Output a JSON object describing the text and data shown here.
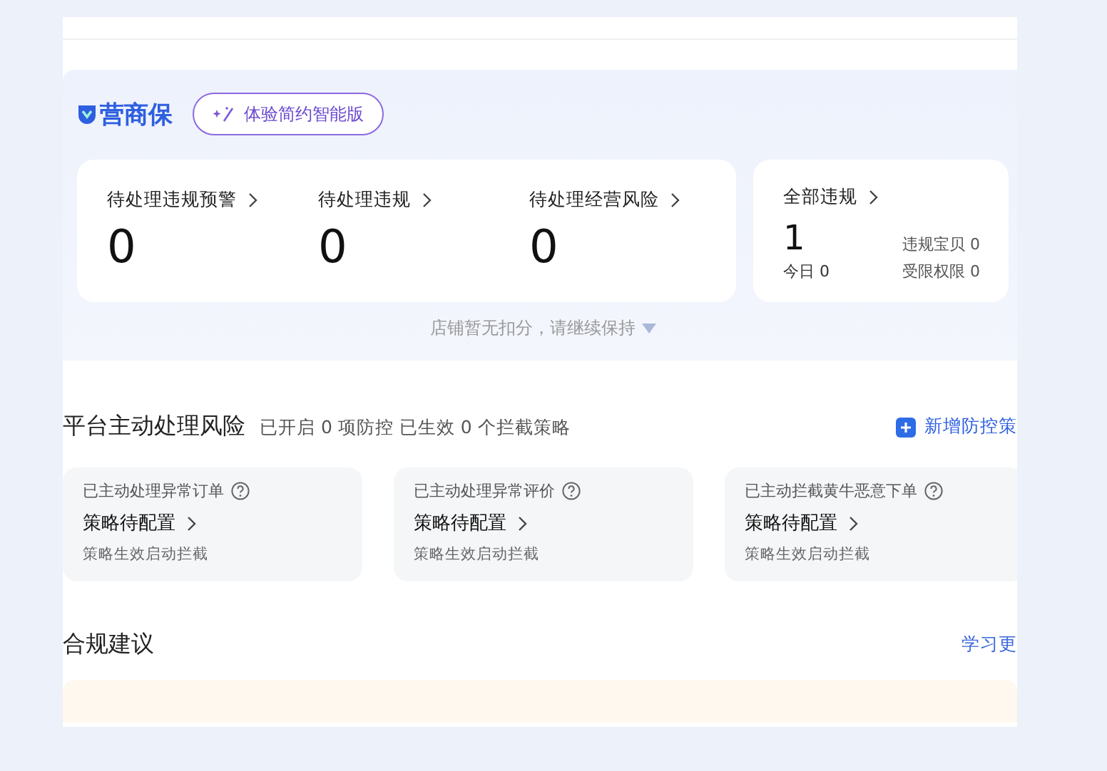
{
  "brand": {
    "name": "营商保",
    "upgrade_button": "体验简约智能版"
  },
  "stats": [
    {
      "label": "待处理违规预警",
      "value": "0"
    },
    {
      "label": "待处理违规",
      "value": "0"
    },
    {
      "label": "待处理经营风险",
      "value": "0"
    }
  ],
  "all_violations": {
    "label": "全部违规",
    "value": "1",
    "today": "今日 0",
    "items": [
      "违规宝贝 0",
      "受限权限 0"
    ]
  },
  "hint": "店铺暂无扣分，请继续保持",
  "risk": {
    "title": "平台主动处理风险",
    "summary": "已开启 0 项防控 已生效 0 个拦截策略",
    "add_button": "新增防控策",
    "cards": [
      {
        "title": "已主动处理异常订单",
        "status": "策略待配置",
        "note": "策略生效启动拦截"
      },
      {
        "title": "已主动处理异常评价",
        "status": "策略待配置",
        "note": "策略生效启动拦截"
      },
      {
        "title": "已主动拦截黄牛恶意下单",
        "status": "策略待配置",
        "note": "策略生效启动拦截"
      }
    ]
  },
  "compliance": {
    "title": "合规建议",
    "link": "学习更"
  }
}
